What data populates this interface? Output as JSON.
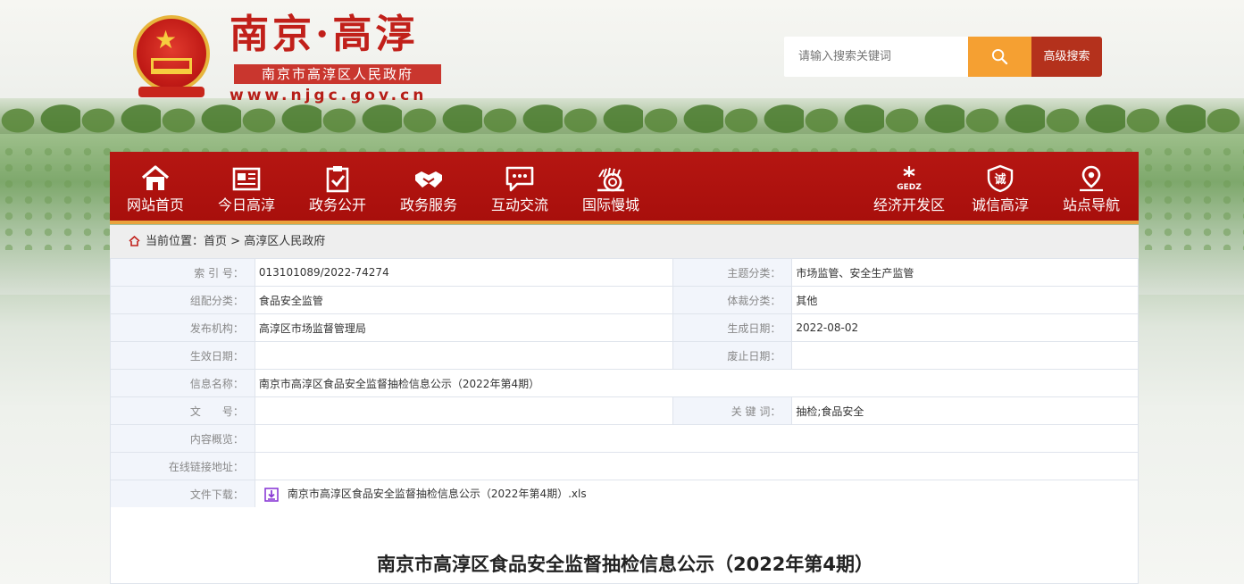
{
  "header": {
    "site_title": "南京·高淳",
    "site_subtitle": "南京市高淳区人民政府",
    "site_url": "www.njgc.gov.cn",
    "search_placeholder": "请输入搜索关键词",
    "search_icon": "search-icon",
    "advanced_search_label": "高级搜索"
  },
  "nav": {
    "items": [
      {
        "label": "网站首页",
        "icon": "home-icon"
      },
      {
        "label": "今日高淳",
        "icon": "newspaper-icon"
      },
      {
        "label": "政务公开",
        "icon": "clipboard-check-icon"
      },
      {
        "label": "政务服务",
        "icon": "handshake-icon"
      },
      {
        "label": "互动交流",
        "icon": "chat-icon"
      },
      {
        "label": "国际慢城",
        "icon": "snail-icon"
      },
      {
        "label": "经济开发区",
        "icon": "gedz-logo-icon",
        "icon_text": "GEDZ"
      },
      {
        "label": "诚信高淳",
        "icon": "integrity-icon",
        "icon_text": "诚"
      },
      {
        "label": "站点导航",
        "icon": "location-pin-icon"
      }
    ]
  },
  "breadcrumb": {
    "prefix": "当前位置：",
    "home": "首页",
    "separator": " > ",
    "current": "高淳区人民政府"
  },
  "info": {
    "index_no_label": "索 引 号：",
    "index_no": "013101089/2022-74274",
    "topic_label": "主题分类：",
    "topic": "市场监管、安全生产监管",
    "org_category_label": "组配分类：",
    "org_category": "食品安全监管",
    "genre_label": "体裁分类：",
    "genre": "其他",
    "publisher_label": "发布机构：",
    "publisher": "高淳区市场监督管理局",
    "created_label": "生成日期：",
    "created": "2022-08-02",
    "effective_label": "生效日期：",
    "effective": "",
    "abolished_label": "废止日期：",
    "abolished": "",
    "name_label": "信息名称：",
    "name": "南京市高淳区食品安全监督抽检信息公示（2022年第4期）",
    "doc_no_label": "文　　号：",
    "doc_no": "",
    "keywords_label": "关 键 词：",
    "keywords": "抽检;食品安全",
    "summary_label": "内容概览：",
    "summary": "",
    "link_label": "在线链接地址：",
    "link": "",
    "file_label": "文件下载：",
    "file": "南京市高淳区食品安全监督抽检信息公示（2022年第4期）.xls"
  },
  "article": {
    "title": "南京市高淳区食品安全监督抽检信息公示（2022年第4期）"
  },
  "colors": {
    "nav_red": "#a80f0c",
    "accent_orange": "#f5a032",
    "advanced_btn": "#b4311c",
    "label_bg": "#f2f5fb"
  }
}
